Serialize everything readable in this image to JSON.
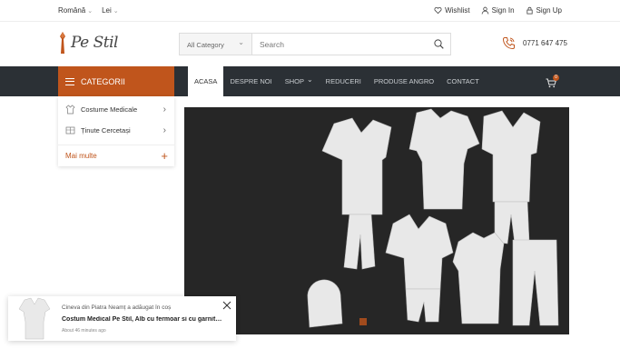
{
  "topbar": {
    "language": "Română",
    "currency": "Lei",
    "wishlist": "Wishlist",
    "sign_in": "Sign In",
    "sign_up": "Sign Up"
  },
  "header": {
    "logo_text": "Pe Stil",
    "search": {
      "category": "All Category",
      "placeholder": "Search"
    },
    "phone": "0771 647 475"
  },
  "nav": {
    "categories_label": "CATEGORII",
    "items": [
      "ACASA",
      "DESPRE NOI",
      "SHOP",
      "REDUCERI",
      "PRODUSE ANGRO",
      "CONTACT"
    ],
    "cart_count": "0"
  },
  "categories": {
    "items": [
      "Costume Medicale",
      "Ținute Cercetași"
    ],
    "more": "Mai multe"
  },
  "colors": {
    "accent": "#c0551c",
    "nav_bg": "#2b3035"
  },
  "toast": {
    "line1": "Cineva din Piatra Neamț a adăugat în coș",
    "product": "Costum Medical Pe Stil, Alb cu fermoar si cu garnitură",
    "time": "About 46 minutes ago"
  }
}
